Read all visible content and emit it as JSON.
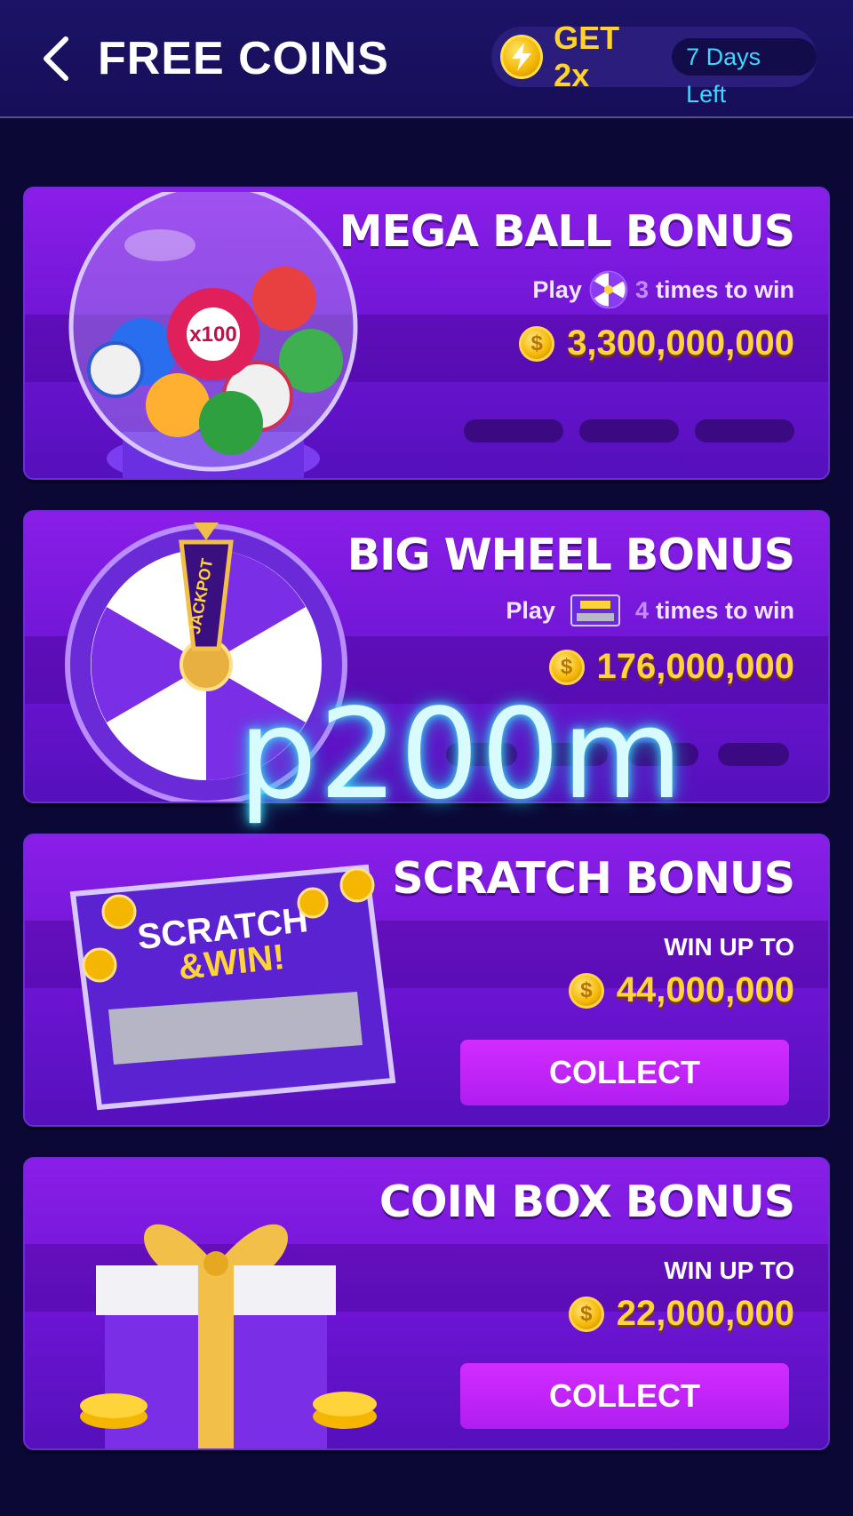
{
  "header": {
    "title": "FREE COINS",
    "boost_label": "GET 2x",
    "boost_days": "7 Days Left",
    "icons": [
      "back-arrow-icon",
      "lightning-bolt-icon"
    ]
  },
  "cards": [
    {
      "title": "MEGA BALL BONUS",
      "play_prefix": "Play",
      "play_count": "3",
      "play_suffix": "times to win",
      "prize": "3,300,000,000",
      "icon": "lottery-ball-globe-icon",
      "mini_icon": "prize-wheel-icon",
      "progress_filled": 0,
      "progress_total": 3
    },
    {
      "title": "BIG WHEEL BONUS",
      "play_prefix": "Play",
      "play_count": "4",
      "play_suffix": "times to win",
      "prize": "176,000,000",
      "icon": "prize-wheel-icon",
      "wheel_label": "JACKPOT",
      "mini_icon": "scratch-card-icon",
      "progress_filled": 0,
      "progress_total": 4
    },
    {
      "title": "SCRATCH BONUS",
      "winup": "WIN UP TO",
      "prize": "44,000,000",
      "button": "COLLECT",
      "icon": "scratch-card-icon",
      "art_text_1": "SCRATCH",
      "art_text_2": "&WIN!"
    },
    {
      "title": "COIN BOX BONUS",
      "winup": "WIN UP TO",
      "prize": "22,000,000",
      "button": "COLLECT",
      "icon": "gift-box-icon"
    }
  ],
  "overlay": {
    "text": "p200m"
  },
  "colors": {
    "background": "#0b0836",
    "card": "#7a18e0",
    "gold": "#ffd33a",
    "button": "#c824f8",
    "days_text": "#3fd7ff"
  }
}
